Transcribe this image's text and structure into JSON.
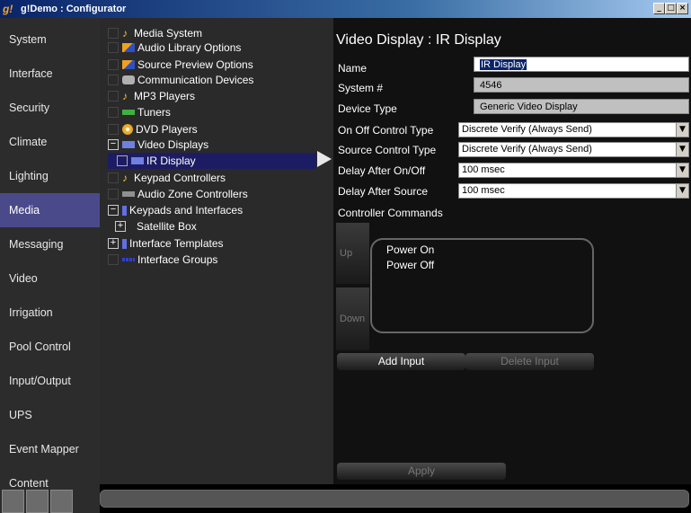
{
  "window": {
    "title": "g!Demo : Configurator",
    "app_icon": "g!"
  },
  "leftnav": {
    "items": [
      {
        "label": "System",
        "active": false
      },
      {
        "label": "Interface",
        "active": false
      },
      {
        "label": "Security",
        "active": false
      },
      {
        "label": "Climate",
        "active": false
      },
      {
        "label": "Lighting",
        "active": false
      },
      {
        "label": "Media",
        "active": true
      },
      {
        "label": "Messaging",
        "active": false
      },
      {
        "label": "Video",
        "active": false
      },
      {
        "label": "Irrigation",
        "active": false
      },
      {
        "label": "Pool Control",
        "active": false
      },
      {
        "label": "Input/Output",
        "active": false
      },
      {
        "label": "UPS",
        "active": false
      },
      {
        "label": "Event Mapper",
        "active": false
      },
      {
        "label": "Content",
        "active": false
      }
    ]
  },
  "tree": {
    "items": [
      {
        "label": "Media System",
        "icon": "music-note-icon"
      },
      {
        "label": "Audio Library Options",
        "icon": "audio-library-icon"
      },
      {
        "label": "Source Preview Options",
        "icon": "source-preview-icon"
      },
      {
        "label": "Communication Devices",
        "icon": "communication-icon"
      },
      {
        "label": "MP3 Players",
        "icon": "music-note-icon"
      },
      {
        "label": "Tuners",
        "icon": "tuner-icon"
      },
      {
        "label": "DVD Players",
        "icon": "dvd-icon"
      },
      {
        "label": "Video Displays",
        "icon": "display-icon"
      },
      {
        "label": "IR Display",
        "icon": "display-icon"
      },
      {
        "label": "Keypad Controllers",
        "icon": "music-note-icon"
      },
      {
        "label": "Audio Zone Controllers",
        "icon": "zone-controller-icon"
      },
      {
        "label": "Keypads and Interfaces",
        "icon": "keypad-icon"
      },
      {
        "label": "Satellite Box",
        "icon": ""
      },
      {
        "label": "Interface Templates",
        "icon": "keypad-icon"
      },
      {
        "label": "Interface Groups",
        "icon": "group-icon"
      }
    ]
  },
  "form": {
    "heading": "Video Display : IR Display",
    "name_label": "Name",
    "name_value": "IR Display",
    "system_label": "System #",
    "system_value": "4546",
    "device_type_label": "Device Type",
    "device_type_value": "Generic Video Display",
    "onoff_label": "On Off Control Type",
    "onoff_value": "Discrete Verify (Always Send)",
    "source_label": "Source Control Type",
    "source_value": "Discrete Verify (Always Send)",
    "delay_onoff_label": "Delay After On/Off",
    "delay_onoff_value": "100 msec",
    "delay_source_label": "Delay After Source",
    "delay_source_value": "100 msec",
    "commands_label": "Controller Commands",
    "up_label": "Up",
    "down_label": "Down",
    "commands": [
      "Power On",
      "Power Off"
    ],
    "add_input_label": "Add Input",
    "delete_input_label": "Delete Input",
    "apply_label": "Apply"
  },
  "colors": {
    "active_nav": "#4a4a8a",
    "selection": "#1c1c64"
  }
}
